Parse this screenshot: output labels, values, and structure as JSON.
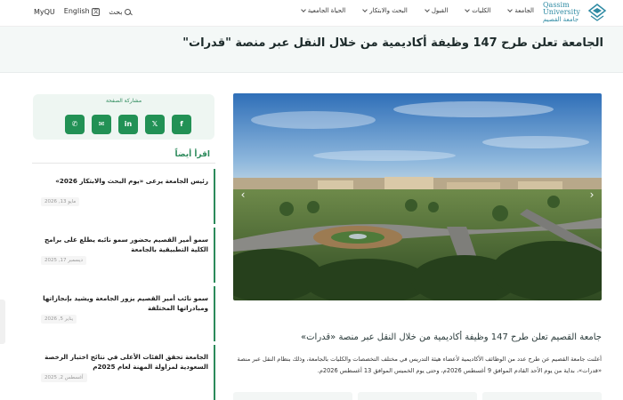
{
  "topnav": {
    "myqu": "MyQU",
    "lang": "English",
    "search": "بحث",
    "menu": [
      {
        "label": "الجامعة"
      },
      {
        "label": "الكليات"
      },
      {
        "label": "القبول"
      },
      {
        "label": "البحث والابتكار"
      },
      {
        "label": "الحياة الجامعية"
      }
    ],
    "logo_en": "Qassim University",
    "logo_ar": "جامعة القصيم"
  },
  "article": {
    "title": "الجامعة تعلن طرح 147 وظيفة أكاديمية من خلال النقل عبر منصة \"قدرات\"",
    "subtitle": "جامعة القصيم تعلن طرح 147 وظيفة أكاديمية من خلال النقل عبر منصة «قدرات»",
    "body": "أعلنت جامعة القصيم عن طرح عدد من الوظائف الأكاديمية لأعضاء هيئة التدريس في مختلف التخصصات والكليات بالجامعة، وذلك بنظام النقل عبر منصة «قدرات»، بداية من يوم الأحد القادم الموافق 9 أغسطس 2026م، وحتى يوم الخميس الموافق 13 أغسطس 2026م."
  },
  "share": {
    "label": "مشاركة الصفحة",
    "buttons": [
      {
        "name": "facebook",
        "glyph": "f"
      },
      {
        "name": "x",
        "glyph": "𝕏"
      },
      {
        "name": "linkedin",
        "glyph": "in"
      },
      {
        "name": "email",
        "glyph": "✉"
      },
      {
        "name": "whatsapp",
        "glyph": "✆"
      }
    ]
  },
  "read_also": {
    "heading": "اقرأ أيضاً",
    "items": [
      {
        "title": "رئيس الجامعة يرعى «يوم البحث والابتكار 2026»",
        "date": "مايو 13, 2026"
      },
      {
        "title": "سمو أمير القصيم بحضور سمو نائبه يطلع على برامج الكلية التطبيقية بالجامعة",
        "date": "ديسمبر 17, 2025"
      },
      {
        "title": "سمو نائب أمير القصيم يزور الجامعة ويشيد بإنجازاتها ومبادراتها المختلفة",
        "date": "يناير 5, 2026"
      },
      {
        "title": "الجامعة تحقق الفئات الأعلى في نتائج اختبار الرخصة السعودية لمزاولة المهنة لعام 2025م",
        "date": "أغسطس 2, 2025"
      }
    ]
  },
  "colors": {
    "accent": "#2c8a5b",
    "share_bg": "#eef6f2",
    "banner_bg": "#f4f8f7"
  }
}
